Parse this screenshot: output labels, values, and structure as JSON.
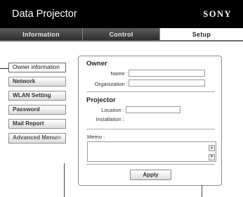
{
  "header": {
    "title": "Data Projector",
    "brand": "SONY"
  },
  "tabs": [
    {
      "label": "Information",
      "active": false
    },
    {
      "label": "Control",
      "active": false
    },
    {
      "label": "Setup",
      "active": true
    }
  ],
  "sidebar": {
    "items": [
      {
        "label": "Owner information",
        "selected": true
      },
      {
        "label": "Network"
      },
      {
        "label": "WLAN Setting"
      },
      {
        "label": "Password"
      },
      {
        "label": "Mail Report"
      },
      {
        "label": "Advanced Menu",
        "icon": "chevron-down-icon"
      }
    ]
  },
  "owner": {
    "title": "Owner",
    "name_label": "Name :",
    "name_value": "",
    "organization_label": "Organization :",
    "organization_value": ""
  },
  "projector": {
    "title": "Projector",
    "location_label": "Location :",
    "location_value": "",
    "installation_label": "Installation :",
    "installation_value": ""
  },
  "memo": {
    "label": "Memo :",
    "value": ""
  },
  "apply_label": "Apply",
  "colors": {
    "header_bg": "#000000",
    "active_tab_bg": "#ffffff",
    "panel_border": "#8a8a8a"
  }
}
